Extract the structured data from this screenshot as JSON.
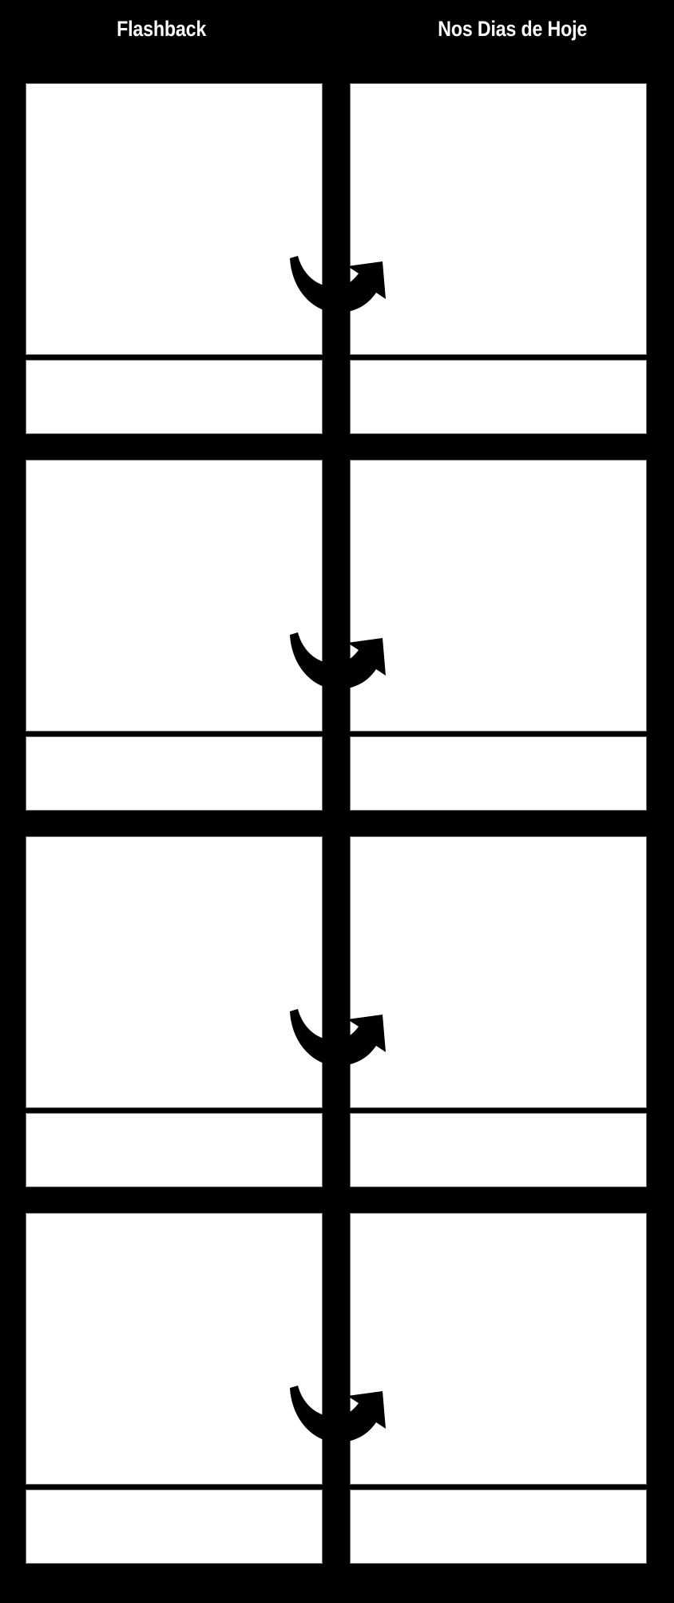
{
  "document": {
    "type": "storyboard-template",
    "background_color": "#000000",
    "panel_color": "#ffffff",
    "panel_border_color": "#6b6b6b",
    "header_text_color": "#ffffff",
    "row_count": 4,
    "column_count": 2
  },
  "header": {
    "columns": [
      {
        "label": "Flashback"
      },
      {
        "label": "Nos Dias de Hoje"
      }
    ]
  },
  "icons": {
    "transition_arrow": "curved-arrow-icon"
  },
  "rows": [
    {
      "index": 1,
      "arrow": "curved-arrow-icon",
      "cells": [
        {
          "column": "Flashback",
          "image": "",
          "caption": ""
        },
        {
          "column": "Nos Dias de Hoje",
          "image": "",
          "caption": ""
        }
      ]
    },
    {
      "index": 2,
      "arrow": "curved-arrow-icon",
      "cells": [
        {
          "column": "Flashback",
          "image": "",
          "caption": ""
        },
        {
          "column": "Nos Dias de Hoje",
          "image": "",
          "caption": ""
        }
      ]
    },
    {
      "index": 3,
      "arrow": "curved-arrow-icon",
      "cells": [
        {
          "column": "Flashback",
          "image": "",
          "caption": ""
        },
        {
          "column": "Nos Dias de Hoje",
          "image": "",
          "caption": ""
        }
      ]
    },
    {
      "index": 4,
      "arrow": "curved-arrow-icon",
      "cells": [
        {
          "column": "Flashback",
          "image": "",
          "caption": ""
        },
        {
          "column": "Nos Dias de Hoje",
          "image": "",
          "caption": ""
        }
      ]
    }
  ]
}
